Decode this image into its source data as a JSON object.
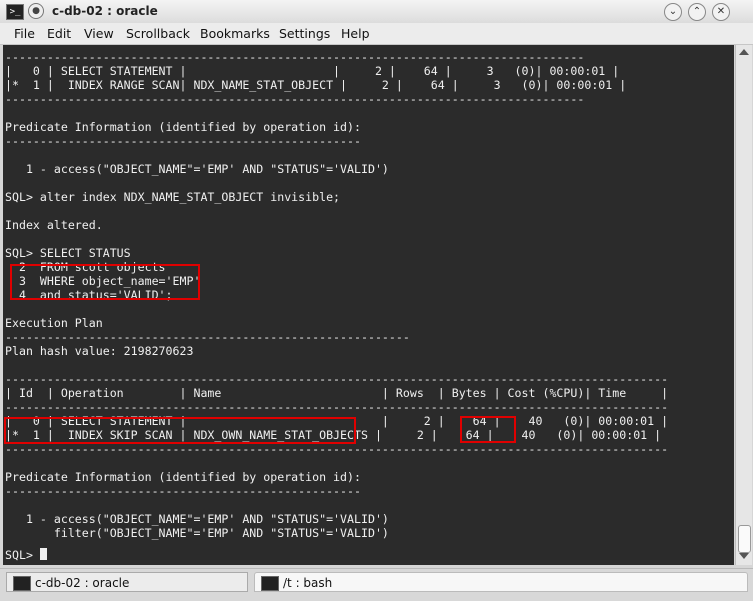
{
  "window": {
    "title": "c-db-02 : oracle"
  },
  "menu": {
    "items": [
      "File",
      "Edit",
      "View",
      "Scrollback",
      "Bookmarks",
      "Settings",
      "Help"
    ]
  },
  "terminal": {
    "lines": [
      "-----------------------------------------------------------------------------------",
      "|   0 | SELECT STATEMENT |                     |     2 |    64 |     3   (0)| 00:00:01 |",
      "|*  1 |  INDEX RANGE SCAN| NDX_NAME_STAT_OBJECT |     2 |    64 |     3   (0)| 00:00:01 |",
      "-----------------------------------------------------------------------------------",
      "",
      "Predicate Information (identified by operation id):",
      "---------------------------------------------------",
      "",
      "   1 - access(\"OBJECT_NAME\"='EMP' AND \"STATUS\"='VALID')",
      "",
      "SQL> alter index NDX_NAME_STAT_OBJECT invisible;",
      "",
      "Index altered.",
      "",
      "SQL> SELECT STATUS",
      "  2  FROM scott objects",
      "  3  WHERE object_name='EMP'",
      "  4  and status='VALID';",
      "",
      "Execution Plan",
      "----------------------------------------------------------",
      "Plan hash value: 2198270623",
      "",
      "-----------------------------------------------------------------------------------------------",
      "| Id  | Operation        | Name                       | Rows  | Bytes | Cost (%CPU)| Time     |",
      "-----------------------------------------------------------------------------------------------",
      "|   0 | SELECT STATEMENT |                            |     2 |    64 |    40   (0)| 00:00:01 |",
      "|*  1 |  INDEX SKIP SCAN | NDX_OWN_NAME_STAT_OBJECTS |     2 |    64 |    40   (0)| 00:00:01 |",
      "-----------------------------------------------------------------------------------------------",
      "",
      "Predicate Information (identified by operation id):",
      "---------------------------------------------------",
      "",
      "   1 - access(\"OBJECT_NAME\"='EMP' AND \"STATUS\"='VALID')",
      "       filter(\"OBJECT_NAME\"='EMP' AND \"STATUS\"='VALID')",
      "",
      "SQL> "
    ]
  },
  "taskbar": {
    "tasks": [
      "c-db-02 : oracle",
      "/t : bash"
    ]
  },
  "icons": {
    "terminal": "terminal-icon",
    "menu": "window-menu-icon",
    "minimize": "minimize-icon",
    "maximize": "maximize-icon",
    "close": "close-icon"
  },
  "colors": {
    "terminal_bg": "#2b2b2b",
    "terminal_fg": "#f0f0f0",
    "highlight": "#e00000"
  }
}
